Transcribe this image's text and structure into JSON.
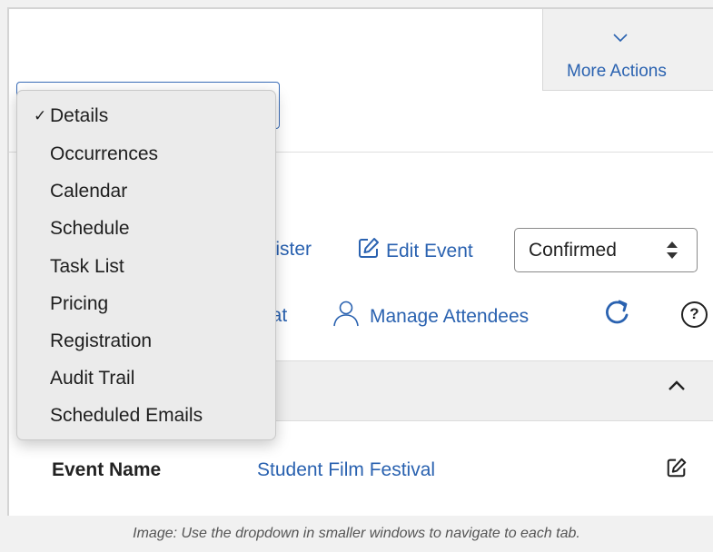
{
  "header": {
    "more_actions_label": "More Actions"
  },
  "actions": {
    "register_partial": "egister",
    "edit_event_label": "Edit Event",
    "chat_partial": "hat",
    "manage_attendees_label": "Manage Attendees",
    "status_value": "Confirmed",
    "help_symbol": "?"
  },
  "dropdown": {
    "selected_mark": "✓",
    "items": [
      {
        "label": "Details",
        "selected": true
      },
      {
        "label": "Occurrences"
      },
      {
        "label": "Calendar"
      },
      {
        "label": "Schedule"
      },
      {
        "label": "Task List"
      },
      {
        "label": "Pricing"
      },
      {
        "label": "Registration"
      },
      {
        "label": "Audit Trail"
      },
      {
        "label": "Scheduled Emails"
      }
    ]
  },
  "details": {
    "field_label": "Event Name",
    "field_value": "Student Film Festival"
  },
  "caption": "Image: Use the dropdown in smaller windows to navigate to each tab.",
  "colors": {
    "link": "#2a62b0",
    "panel": "#efefef",
    "dropdown_bg": "#ebebeb"
  },
  "icons": [
    "chevron-down-icon",
    "edit-icon",
    "person-icon",
    "refresh-icon",
    "help-icon",
    "chevron-up-icon",
    "select-arrows-icon"
  ]
}
